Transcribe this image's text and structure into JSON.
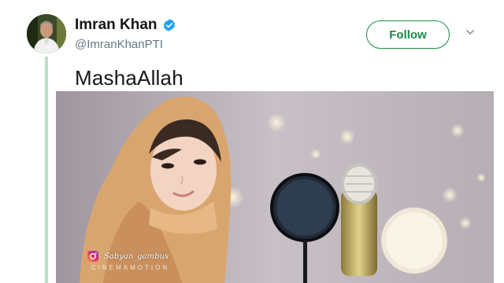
{
  "author": {
    "display_name": "Imran Khan",
    "handle": "@ImranKhanPTI",
    "verified_icon": "verified-badge-icon"
  },
  "actions": {
    "follow_label": "Follow",
    "more_icon": "chevron-down-icon"
  },
  "tweet": {
    "text": "MashaAllah"
  },
  "media": {
    "watermark": "Sabyan_gambus",
    "watermark_sub": "CINEMAMOTION",
    "watermark_icon": "instagram-icon"
  },
  "colors": {
    "follow_accent": "#1a8a46",
    "verified_blue": "#1da1f2",
    "thread_line": "#b8e0c4"
  }
}
